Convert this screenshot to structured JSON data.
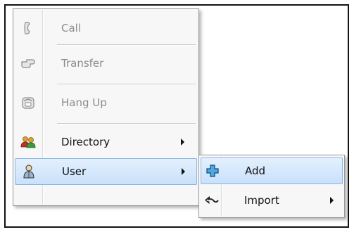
{
  "menu": {
    "items": [
      {
        "label": "Call",
        "icon": "phone-handset-icon",
        "enabled": false
      },
      {
        "label": "Transfer",
        "icon": "transfer-hand-icon",
        "enabled": false
      },
      {
        "label": "Hang Up",
        "icon": "desk-phone-icon",
        "enabled": false
      },
      {
        "label": "Directory",
        "icon": "users-group-icon",
        "enabled": true,
        "has_submenu": true
      },
      {
        "label": "User",
        "icon": "user-icon",
        "enabled": true,
        "has_submenu": true,
        "highlighted": true
      }
    ]
  },
  "submenu": {
    "items": [
      {
        "label": "Add",
        "icon": "add-plus-icon",
        "highlighted": true
      },
      {
        "label": "Import",
        "icon": "import-arrow-icon",
        "has_submenu": true
      }
    ]
  },
  "colors": {
    "highlight_top": "#e3f0fd",
    "highlight_bottom": "#c9e1fb",
    "highlight_border": "#8bb6e6",
    "disabled_text": "#8c8c8c",
    "menu_background": "#f7f7f7"
  }
}
